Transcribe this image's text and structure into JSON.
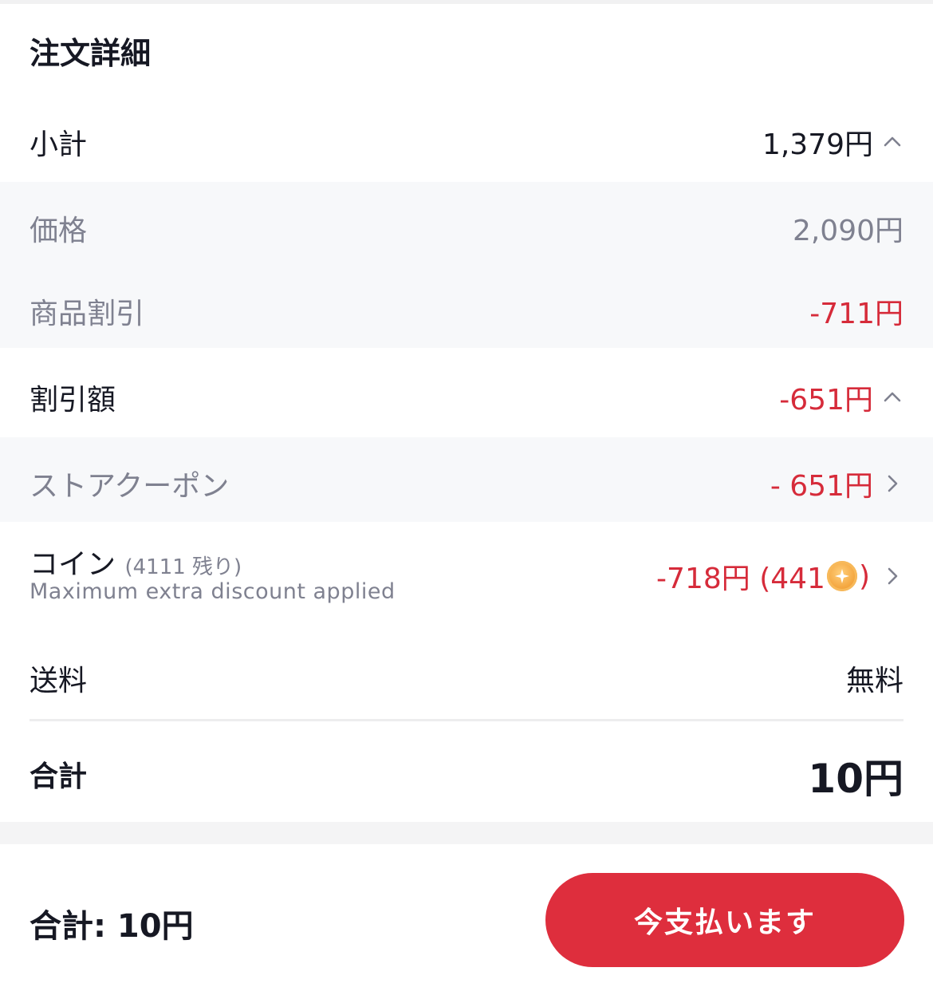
{
  "order_details": {
    "title": "注文詳細",
    "subtotal": {
      "label": "小計",
      "value": "1,379円"
    },
    "price": {
      "label": "価格",
      "value": "2,090円"
    },
    "product_discount": {
      "label": "商品割引",
      "value": "-711円"
    },
    "discount_total": {
      "label": "割引額",
      "value": "-651円"
    },
    "store_coupon": {
      "label": "ストアクーポン",
      "value": "- 651円"
    },
    "coins": {
      "label": "コイン",
      "remaining": "(4111 残り)",
      "note": "Maximum extra discount applied",
      "value_prefix": "-718円 (441",
      "value_suffix": ")"
    },
    "shipping": {
      "label": "送料",
      "value": "無料"
    },
    "total": {
      "label": "合計",
      "value": "10円"
    }
  },
  "footer": {
    "total_text": "合計: 10円",
    "pay_button_label": "今支払います"
  },
  "colors": {
    "accent_red": "#de2e3d",
    "discount_red": "#d62b3a",
    "muted_text": "#7f8190",
    "gray_background": "#f7f8fa",
    "coin_orange": "#f3a33b"
  },
  "icons": {
    "expand": "chevron-up-icon",
    "navigate": "chevron-right-icon",
    "coin": "coin-icon"
  }
}
